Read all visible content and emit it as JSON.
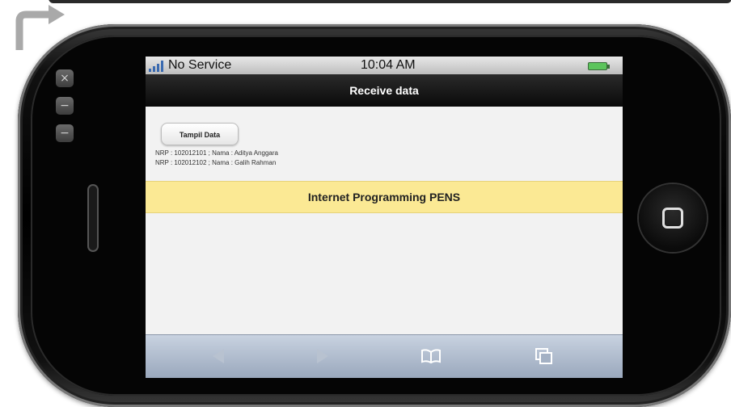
{
  "status_bar": {
    "carrier": "No Service",
    "time": "10:04 AM"
  },
  "nav": {
    "title": "Receive data"
  },
  "content": {
    "button_label": "Tampil Data",
    "records": [
      "NRP : 102012101 ; Nama : Aditya Anggara",
      "NRP : 102012102 ; Nama : Galih Rahman"
    ],
    "banner": "Internet Programming PENS"
  },
  "side_buttons": [
    "×",
    "−",
    "−"
  ],
  "toolbar": {
    "icons": [
      "back-icon",
      "forward-icon",
      "bookmarks-icon",
      "pages-icon"
    ]
  },
  "colors": {
    "banner_bg": "#fbe994",
    "title_bar_bg": "#111111",
    "battery": "#5cc45c",
    "toolbar_bg": "#b3bfd0"
  }
}
